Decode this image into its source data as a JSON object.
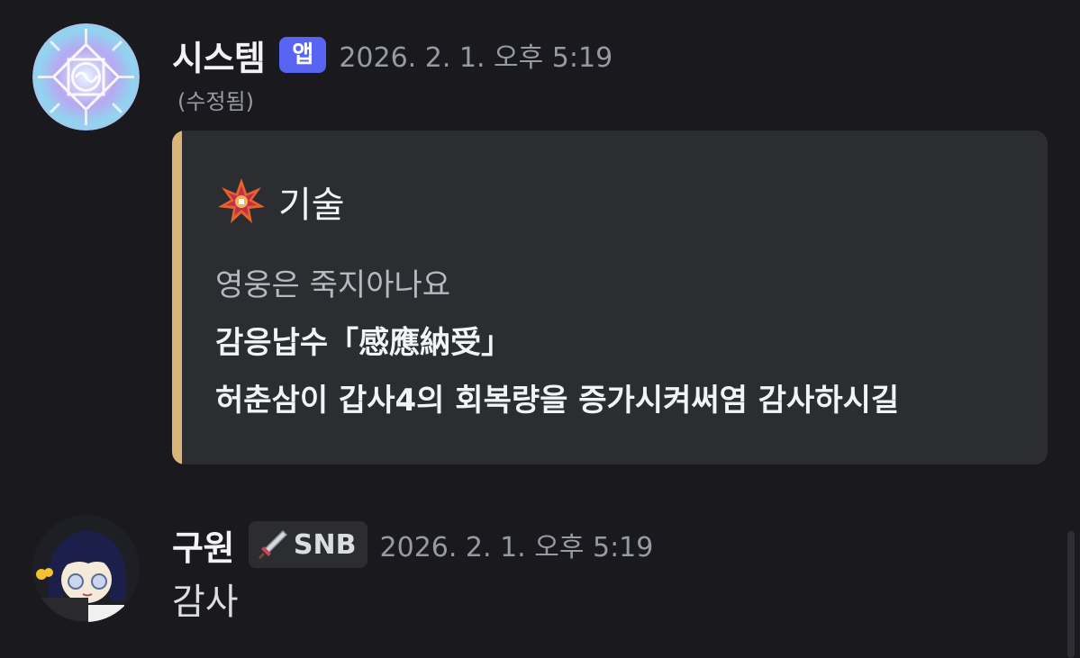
{
  "messages": [
    {
      "username": "시스템",
      "badge": "앱",
      "timestamp": "2026. 2. 1. 오후 5:19",
      "edited": "(수정됨)",
      "avatar_icon": "mandala-emblem-avatar",
      "embed": {
        "accent_color": "#d8b67a",
        "author_icon": "spiky-star-icon",
        "author": "기술",
        "lines": [
          {
            "text": "영웅은 죽지아나요",
            "style": "plain"
          },
          {
            "text": "감응납수「感應納受」",
            "style": "bold"
          },
          {
            "text": "허춘삼이 갑사4의 회복량을 증가시켜써염 감사하시길",
            "style": "bold"
          }
        ]
      }
    },
    {
      "username": "구원",
      "role_icon": "sword-icon",
      "role": "SNB",
      "timestamp": "2026. 2. 1. 오후 5:19",
      "avatar_icon": "anime-character-avatar",
      "content": "감사"
    }
  ],
  "colors": {
    "background": "#1a1a1e",
    "app_badge": "#5865f2",
    "embed_background": "#2b2d31",
    "muted_text": "#949ba4"
  }
}
